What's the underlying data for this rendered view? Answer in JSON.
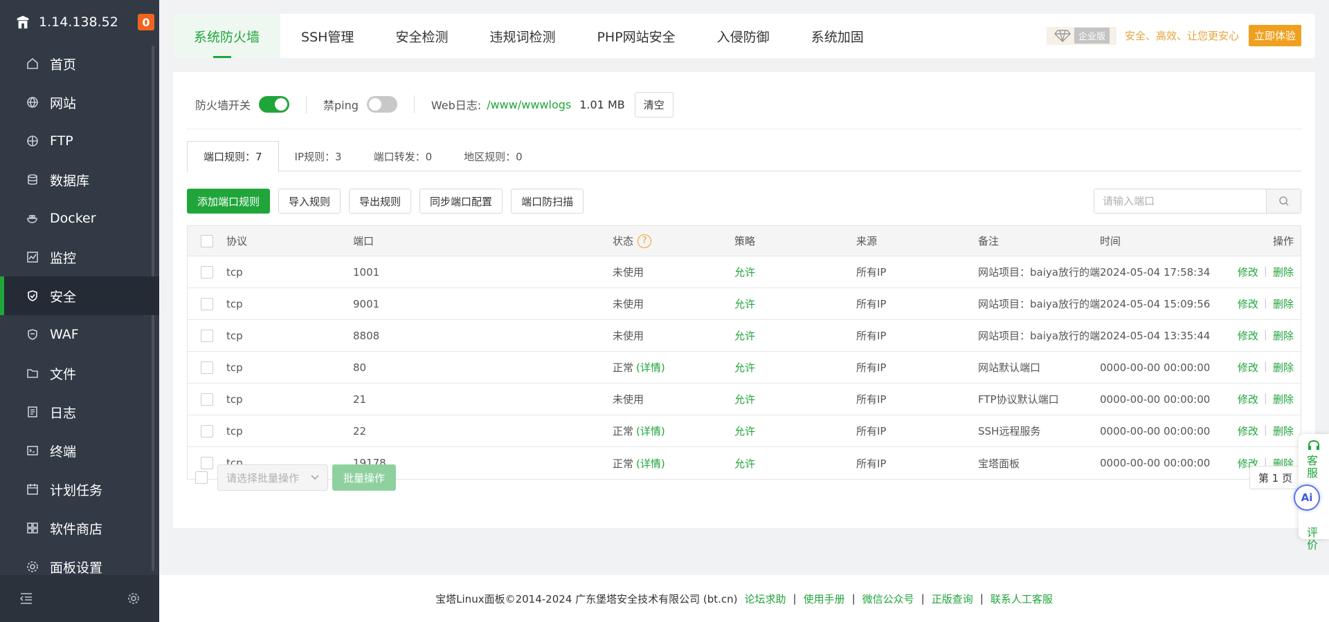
{
  "sidebar": {
    "server_ip": "1.14.138.52",
    "badge": "0",
    "items": [
      {
        "label": "首页",
        "icon": "home-icon"
      },
      {
        "label": "网站",
        "icon": "globe-icon"
      },
      {
        "label": "FTP",
        "icon": "ftp-icon"
      },
      {
        "label": "数据库",
        "icon": "database-icon"
      },
      {
        "label": "Docker",
        "icon": "docker-icon"
      },
      {
        "label": "监控",
        "icon": "monitor-icon"
      },
      {
        "label": "安全",
        "icon": "shield-icon"
      },
      {
        "label": "WAF",
        "icon": "waf-icon"
      },
      {
        "label": "文件",
        "icon": "folder-icon"
      },
      {
        "label": "日志",
        "icon": "log-icon"
      },
      {
        "label": "终端",
        "icon": "terminal-icon"
      },
      {
        "label": "计划任务",
        "icon": "calendar-icon"
      },
      {
        "label": "软件商店",
        "icon": "apps-icon"
      },
      {
        "label": "面板设置",
        "icon": "settings-icon"
      }
    ],
    "active_index": 6
  },
  "top_tabs": [
    "系统防火墙",
    "SSH管理",
    "安全检测",
    "违规词检测",
    "PHP网站安全",
    "入侵防御",
    "系统加固"
  ],
  "promo": {
    "tag": "企业版",
    "text": "安全、高效、让您更安心",
    "button": "立即体验"
  },
  "firewall": {
    "switch_label": "防火墙开关",
    "switch_on": true,
    "ping_label": "禁ping",
    "ping_on": false,
    "weblog_label": "Web日志:",
    "weblog_path": "/www/wwwlogs",
    "weblog_size": "1.01 MB",
    "clear_label": "清空"
  },
  "sub_tabs": [
    "端口规则：7",
    "IP规则：3",
    "端口转发：0",
    "地区规则：0"
  ],
  "toolbar": {
    "add": "添加端口规则",
    "import": "导入规则",
    "export": "导出规则",
    "sync": "同步端口配置",
    "scan": "端口防扫描",
    "search_placeholder": "请输入端口"
  },
  "table": {
    "headers": {
      "protocol": "协议",
      "port": "端口",
      "status": "状态",
      "policy": "策略",
      "source": "来源",
      "note": "备注",
      "time": "时间",
      "ops": "操作"
    },
    "edit": "修改",
    "delete": "删除",
    "detail": "(详情)",
    "rows": [
      {
        "protocol": "tcp",
        "port": "1001",
        "status": "未使用",
        "detail": false,
        "policy": "允许",
        "source": "所有IP",
        "note": "网站项目：baiya放行的端口",
        "time": "2024-05-04 17:58:34"
      },
      {
        "protocol": "tcp",
        "port": "9001",
        "status": "未使用",
        "detail": false,
        "policy": "允许",
        "source": "所有IP",
        "note": "网站项目：baiya放行的端口",
        "time": "2024-05-04 15:09:56"
      },
      {
        "protocol": "tcp",
        "port": "8808",
        "status": "未使用",
        "detail": false,
        "policy": "允许",
        "source": "所有IP",
        "note": "网站项目：baiya放行的端口",
        "time": "2024-05-04 13:35:44"
      },
      {
        "protocol": "tcp",
        "port": "80",
        "status": "正常",
        "detail": true,
        "policy": "允许",
        "source": "所有IP",
        "note": "网站默认端口",
        "time": "0000-00-00 00:00:00"
      },
      {
        "protocol": "tcp",
        "port": "21",
        "status": "未使用",
        "detail": false,
        "policy": "允许",
        "source": "所有IP",
        "note": "FTP协议默认端口",
        "time": "0000-00-00 00:00:00"
      },
      {
        "protocol": "tcp",
        "port": "22",
        "status": "正常",
        "detail": true,
        "policy": "允许",
        "source": "所有IP",
        "note": "SSH远程服务",
        "time": "0000-00-00 00:00:00"
      },
      {
        "protocol": "tcp",
        "port": "19178",
        "status": "正常",
        "detail": true,
        "policy": "允许",
        "source": "所有IP",
        "note": "宝塔面板",
        "time": "0000-00-00 00:00:00"
      }
    ]
  },
  "batch": {
    "select_placeholder": "请选择批量操作",
    "button": "批量操作",
    "pager": "第 1 页"
  },
  "float_widget": {
    "service": "客服",
    "ai": "Ai",
    "review": "评价"
  },
  "footer": {
    "copyright": "宝塔Linux面板©2014-2024 广东堡塔安全技术有限公司 (bt.cn)",
    "links": [
      "论坛求助",
      "使用手册",
      "微信公众号",
      "正版查询",
      "联系人工客服"
    ]
  },
  "colors": {
    "accent": "#20a53a",
    "sidebar_bg": "#323a46",
    "badge": "#f0641e",
    "promo": "#f0a020"
  }
}
